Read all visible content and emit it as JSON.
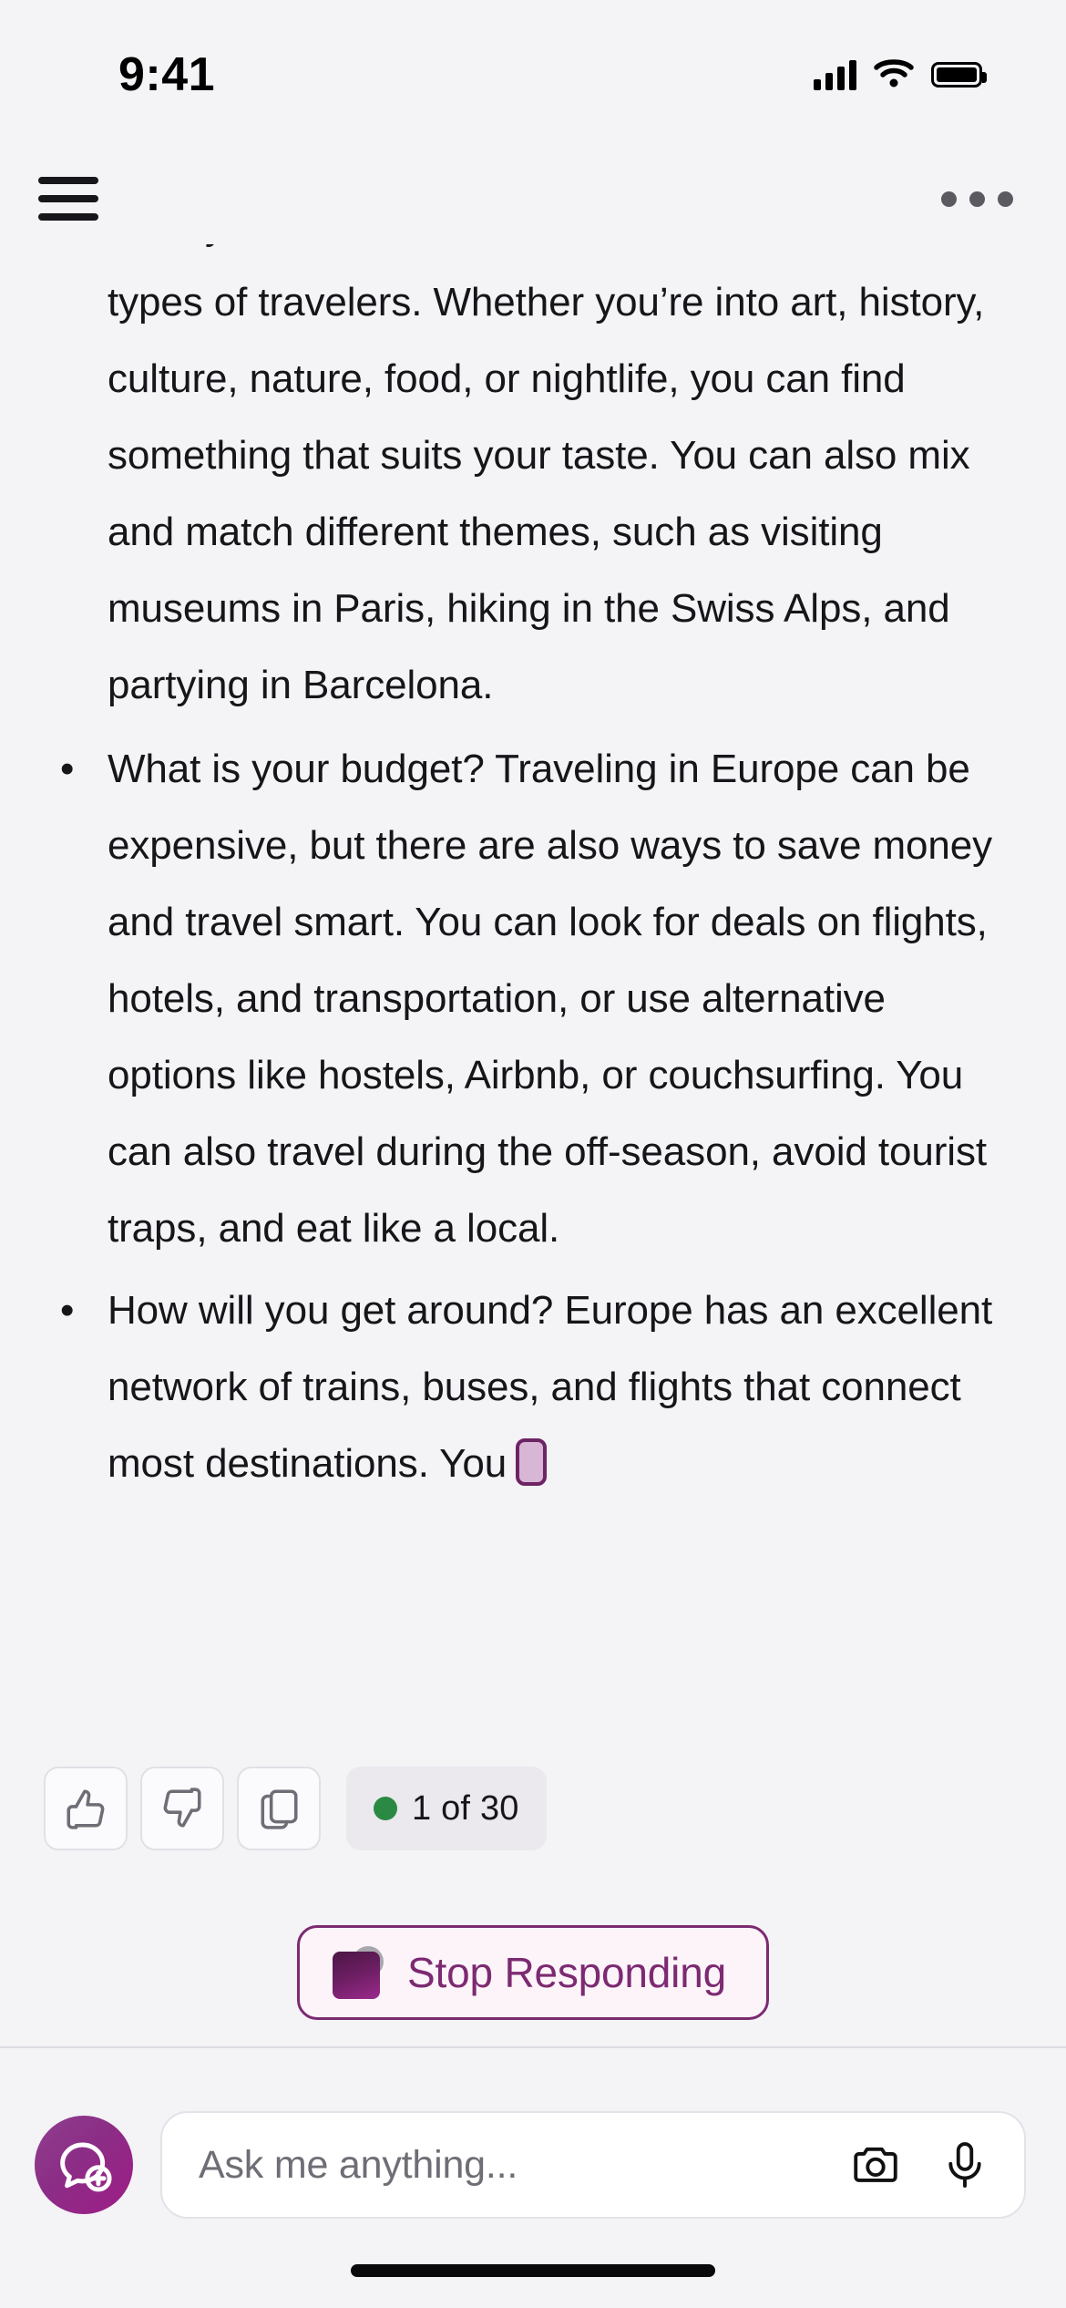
{
  "status_bar": {
    "time": "9:41",
    "cellular_icon": "signal-bars-icon",
    "wifi_icon": "wifi-icon",
    "battery_icon": "battery-full-icon"
  },
  "nav_bar": {
    "menu_icon": "hamburger-menu-icon",
    "overflow_icon": "more-options-icon"
  },
  "message": {
    "clipped_line": "",
    "paragraph": "variety of attractions and activities for different types of travelers. Whether you’re into art, history, culture, nature, food, or nightlife, you can find something that suits your taste. You can also mix and match different themes, such as visiting museums in Paris, hiking in the Swiss Alps, and partying in Barcelona.",
    "bullets": [
      "What is your budget? Traveling in Europe can be expensive, but there are also ways to save money and travel smart. You can look for deals on flights, hotels, and transportation, or use alternative options like hostels, Airbnb, or couchsurfing. You can also travel during the off-season, avoid tourist traps, and eat like a local.",
      "How will you get around? Europe has an excellent network of trains, buses, and flights that connect most destinations. You"
    ],
    "streaming_caret": "typing-caret"
  },
  "feedback": {
    "thumbs_up_icon": "thumbs-up-icon",
    "thumbs_down_icon": "thumbs-down-icon",
    "copy_icon": "copy-icon",
    "counter_label": "1 of 30",
    "status_dot_color": "#2a8a43"
  },
  "stop": {
    "label": "Stop Responding",
    "icon": "stop-square-icon",
    "border_color": "#7c2a72",
    "background_color": "#fdf4fa",
    "text_color": "#7c2a72"
  },
  "composer": {
    "new_chat_icon": "new-chat-bubble-plus-icon",
    "placeholder": "Ask me anything...",
    "value": "",
    "camera_icon": "camera-icon",
    "mic_icon": "microphone-icon",
    "accent_color": "#9e1c86"
  },
  "home_indicator": "home-indicator"
}
